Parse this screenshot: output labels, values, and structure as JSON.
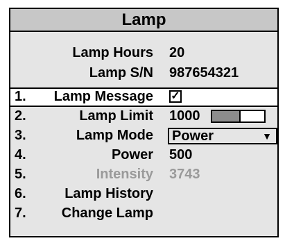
{
  "title": "Lamp",
  "info": [
    {
      "label": "Lamp Hours",
      "value": "20"
    },
    {
      "label": "Lamp S/N",
      "value": "987654321"
    }
  ],
  "items": [
    {
      "num": "1.",
      "label": "Lamp Message",
      "checked_glyph": "✓"
    },
    {
      "num": "2.",
      "label": "Lamp Limit",
      "value": "1000",
      "slider_fraction": 0.55
    },
    {
      "num": "3.",
      "label": "Lamp Mode",
      "value": "Power",
      "arrow": "▼"
    },
    {
      "num": "4.",
      "label": "Power",
      "value": "500"
    },
    {
      "num": "5.",
      "label": "Intensity",
      "value": "3743"
    },
    {
      "num": "6.",
      "label": "Lamp History"
    },
    {
      "num": "7.",
      "label": "Change Lamp"
    }
  ],
  "colors": {
    "panel": "#e5e5e5",
    "title_bar": "#c7c7c7",
    "selected_row": "#ffffff",
    "disabled_text": "#9a9a9a",
    "slider_fill": "#8c8c8c"
  }
}
